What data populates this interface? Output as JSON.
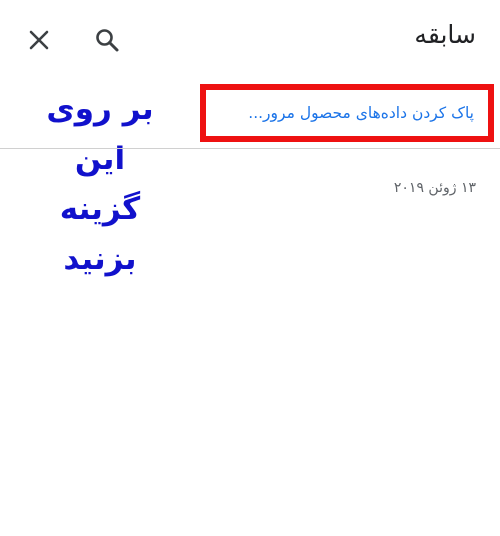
{
  "header": {
    "title": "سابقه",
    "close_icon": "close-icon",
    "search_icon": "search-icon"
  },
  "actions": {
    "clear_browsing_data": "پاک کردن داده‌های محصول مرور..."
  },
  "annotation": {
    "line1": "بر روی این",
    "line2": "گزینه بزنید",
    "color": "#1111cc",
    "highlight_color": "#ee1111"
  },
  "history": {
    "groups": [
      {
        "date": "۱۳ ژوئن ۲۰۱۹"
      }
    ]
  },
  "colors": {
    "link": "#1a73e8",
    "text": "#202124",
    "secondary_text": "#5f6368"
  }
}
